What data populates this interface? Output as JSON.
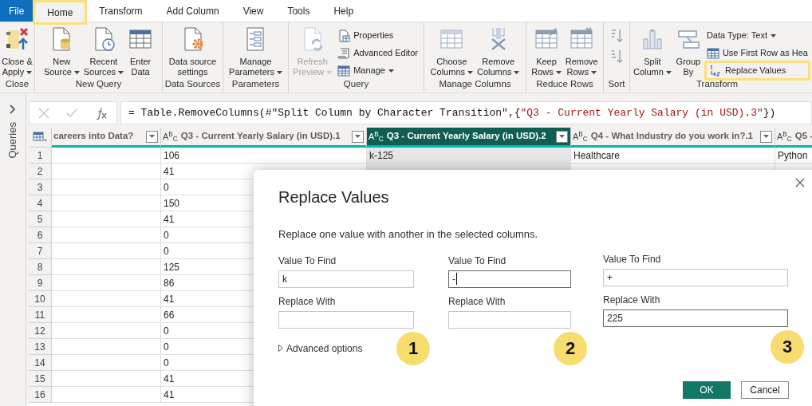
{
  "tabs": [
    {
      "label": "File",
      "kind": "file",
      "selected": false,
      "highlighted": false
    },
    {
      "label": "Home",
      "kind": "tab",
      "selected": true,
      "highlighted": true
    },
    {
      "label": "Transform",
      "kind": "tab",
      "selected": false,
      "highlighted": false
    },
    {
      "label": "Add Column",
      "kind": "tab",
      "selected": false,
      "highlighted": false
    },
    {
      "label": "View",
      "kind": "tab",
      "selected": false,
      "highlighted": false
    },
    {
      "label": "Tools",
      "kind": "tab",
      "selected": false,
      "highlighted": false
    },
    {
      "label": "Help",
      "kind": "tab",
      "selected": false,
      "highlighted": false
    }
  ],
  "ribbon": {
    "groups": [
      {
        "label": "Close",
        "items": [
          {
            "kind": "large",
            "lines": [
              "Close &",
              "Apply"
            ],
            "dropdown": true,
            "disabled": false
          }
        ]
      },
      {
        "label": "New Query",
        "items": [
          {
            "kind": "large",
            "lines": [
              "New",
              "Source"
            ],
            "dropdown": true,
            "disabled": false
          },
          {
            "kind": "large",
            "lines": [
              "Recent",
              "Sources"
            ],
            "dropdown": true,
            "disabled": false
          },
          {
            "kind": "large",
            "lines": [
              "Enter",
              "Data"
            ],
            "dropdown": false,
            "disabled": false
          }
        ]
      },
      {
        "label": "Data Sources",
        "items": [
          {
            "kind": "large",
            "lines": [
              "Data source",
              "settings"
            ],
            "dropdown": false,
            "disabled": false
          }
        ]
      },
      {
        "label": "Parameters",
        "items": [
          {
            "kind": "large",
            "lines": [
              "Manage",
              "Parameters"
            ],
            "dropdown": true,
            "disabled": false
          }
        ]
      },
      {
        "label": "Query",
        "items": [
          {
            "kind": "large",
            "lines": [
              "Refresh",
              "Preview"
            ],
            "dropdown": true,
            "disabled": true
          },
          {
            "kind": "stack",
            "items": [
              {
                "label": "Properties",
                "dropdown": false,
                "highlighted": false
              },
              {
                "label": "Advanced Editor",
                "dropdown": false,
                "highlighted": false
              },
              {
                "label": "Manage",
                "dropdown": true,
                "highlighted": false
              }
            ]
          }
        ]
      },
      {
        "label": "Manage Columns",
        "items": [
          {
            "kind": "large",
            "lines": [
              "Choose",
              "Columns"
            ],
            "dropdown": true,
            "disabled": false
          },
          {
            "kind": "large",
            "lines": [
              "Remove",
              "Columns"
            ],
            "dropdown": true,
            "disabled": false
          }
        ]
      },
      {
        "label": "Reduce Rows",
        "items": [
          {
            "kind": "large",
            "lines": [
              "Keep",
              "Rows"
            ],
            "dropdown": true,
            "disabled": false
          },
          {
            "kind": "large",
            "lines": [
              "Remove",
              "Rows"
            ],
            "dropdown": true,
            "disabled": false
          }
        ]
      },
      {
        "label": "Sort",
        "items": [
          {
            "kind": "sort"
          }
        ]
      },
      {
        "label": "Transform",
        "items": [
          {
            "kind": "large",
            "lines": [
              "Split",
              "Column"
            ],
            "dropdown": true,
            "disabled": false
          },
          {
            "kind": "large",
            "lines": [
              "Group",
              "By"
            ],
            "dropdown": false,
            "disabled": false
          },
          {
            "kind": "stack",
            "items": [
              {
                "label": "Data Type: Text",
                "dropdown": true,
                "highlighted": false
              },
              {
                "label": "Use First Row as Hea",
                "dropdown": false,
                "highlighted": false
              },
              {
                "label": "Replace Values",
                "dropdown": false,
                "highlighted": true
              }
            ]
          }
        ]
      }
    ]
  },
  "sidebar": {
    "label": "Queries"
  },
  "formula_bar": {
    "parts": [
      {
        "kind": "plain",
        "text": "= Table.RemoveColumns(#\"Split Column by Character Transition\",{"
      },
      {
        "kind": "string",
        "text": "\"Q3 - Current Yearly Salary (in USD).3\""
      },
      {
        "kind": "plain",
        "text": "})"
      }
    ]
  },
  "table": {
    "columns": [
      {
        "title": "careers into Data?",
        "selected": false
      },
      {
        "title": "Q3 - Current Yearly Salary (in USD).1",
        "type": "A$^{B}$$_{C}$",
        "selected": false
      },
      {
        "title": "Q3 - Current Yearly Salary (in USD).2",
        "type": "A$^{B}$$_{C}$",
        "selected": true
      },
      {
        "title": "Q4 - What Industry do you work in?.1",
        "type": "A$^{B}$$_{C}$",
        "selected": false
      },
      {
        "title": "Q5 -",
        "type": "A$^{B}$$_{C}$",
        "selected": false
      }
    ],
    "rows": [
      {
        "number": "1",
        "cells": [
          null,
          "106",
          "k-125",
          "Healthcare",
          "Python"
        ]
      },
      {
        "number": "2",
        "cells": [
          null,
          "41",
          null,
          null,
          null
        ]
      },
      {
        "number": "3",
        "cells": [
          null,
          "0",
          null,
          null,
          null
        ]
      },
      {
        "number": "4",
        "cells": [
          null,
          "150",
          null,
          null,
          null
        ]
      },
      {
        "number": "5",
        "cells": [
          null,
          "41",
          null,
          null,
          null
        ]
      },
      {
        "number": "6",
        "cells": [
          null,
          "0",
          null,
          null,
          null
        ]
      },
      {
        "number": "7",
        "cells": [
          null,
          "0",
          null,
          null,
          null
        ]
      },
      {
        "number": "8",
        "cells": [
          null,
          "125",
          null,
          null,
          null
        ]
      },
      {
        "number": "9",
        "cells": [
          null,
          "86",
          null,
          null,
          null
        ]
      },
      {
        "number": "10",
        "cells": [
          null,
          "41",
          null,
          null,
          null
        ]
      },
      {
        "number": "11",
        "cells": [
          null,
          "66",
          null,
          null,
          null
        ]
      },
      {
        "number": "12",
        "cells": [
          null,
          "0",
          null,
          null,
          null
        ]
      },
      {
        "number": "13",
        "cells": [
          null,
          "0",
          null,
          null,
          null
        ]
      },
      {
        "number": "14",
        "cells": [
          null,
          "0",
          null,
          null,
          null
        ]
      },
      {
        "number": "15",
        "cells": [
          null,
          "41",
          null,
          null,
          null
        ]
      },
      {
        "number": "16",
        "cells": [
          null,
          "41",
          null,
          null,
          null
        ]
      }
    ]
  },
  "dialog": {
    "title": "Replace Values",
    "description": "Replace one value with another in the selected columns.",
    "field_sets": [
      {
        "badge": "1",
        "fields": [
          {
            "label": "Value To Find",
            "value": "k",
            "focused": false,
            "cursor": false
          },
          {
            "label": "Replace With",
            "focused": false,
            "cursor": false
          }
        ]
      },
      {
        "badge": "2",
        "fields": [
          {
            "label": "Value To Find",
            "value": "-",
            "focused": true,
            "cursor": true
          },
          {
            "label": "Replace With",
            "focused": false,
            "cursor": false
          }
        ]
      },
      {
        "badge": "3",
        "fields": [
          {
            "label": "Value To Find",
            "value": "+",
            "focused": false,
            "cursor": false
          },
          {
            "label": "Replace With",
            "value": "225",
            "focused": true,
            "cursor": false
          }
        ]
      }
    ],
    "advanced_options": "Advanced options",
    "buttons": [
      {
        "label": "OK",
        "kind": "primary"
      },
      {
        "label": "Cancel",
        "kind": "secondary"
      }
    ]
  }
}
